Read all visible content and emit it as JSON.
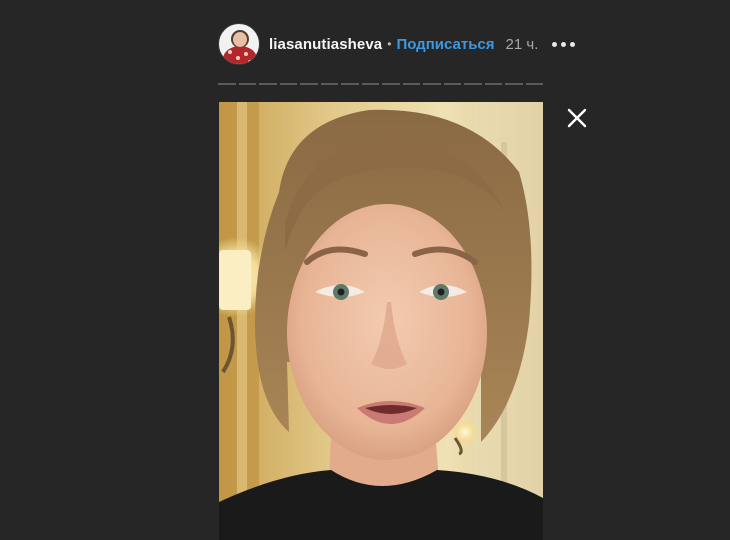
{
  "header": {
    "avatar_icon": "user-avatar",
    "username": "liasanutiasheva",
    "separator": "•",
    "follow_label": "Подписаться",
    "time": "21 ч.",
    "more_icon": "more-horizontal-icon"
  },
  "progress": {
    "segments": 16
  },
  "story": {
    "media": "video-frame"
  },
  "controls": {
    "close_icon": "close-icon"
  },
  "colors": {
    "background": "#262626",
    "follow": "#3d98e0",
    "username": "#f5f5f5",
    "time": "#a8a8a8"
  }
}
